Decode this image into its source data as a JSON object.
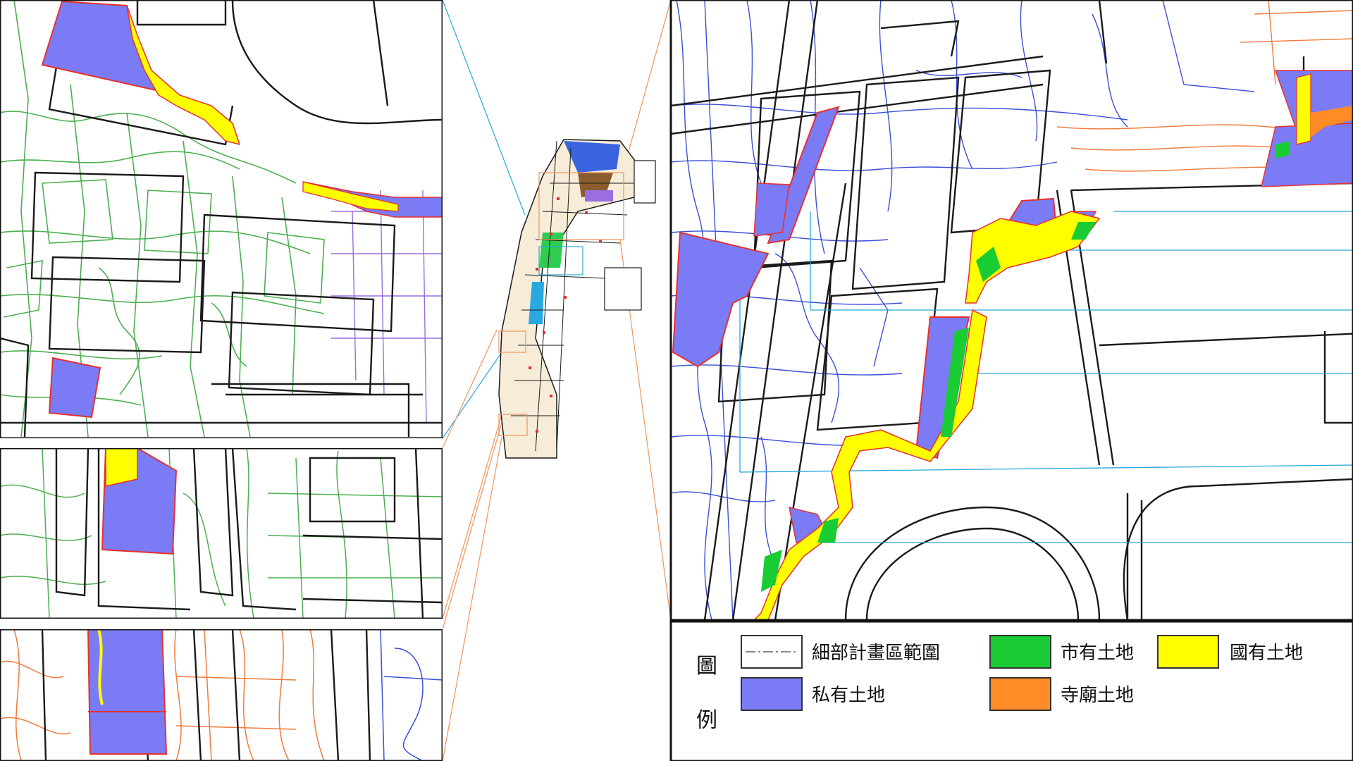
{
  "legend": {
    "title_chars": [
      "圖",
      "例"
    ],
    "items": [
      {
        "key": "boundary",
        "label": "細部計畫區範圍",
        "swatch": "boundary"
      },
      {
        "key": "city",
        "label": "市有土地",
        "color": "#19cc33"
      },
      {
        "key": "national",
        "label": "國有土地",
        "color": "#ffff00"
      },
      {
        "key": "private",
        "label": "私有土地",
        "color": "#7b7bf5"
      },
      {
        "key": "temple",
        "label": "寺廟土地",
        "color": "#ff8c26"
      }
    ]
  },
  "colors": {
    "parcel_green": "#4caf50",
    "parcel_blue": "#3a4fd8",
    "parcel_orange": "#f07a3a",
    "parcel_purple": "#9a6ee0",
    "block_black": "#1a1a1a",
    "guide_cyan": "#29a8d8",
    "guide_orange": "#f0945a",
    "boundary_red": "#e53030"
  },
  "icons": [
    "overview-minimap",
    "legend-swatch"
  ]
}
